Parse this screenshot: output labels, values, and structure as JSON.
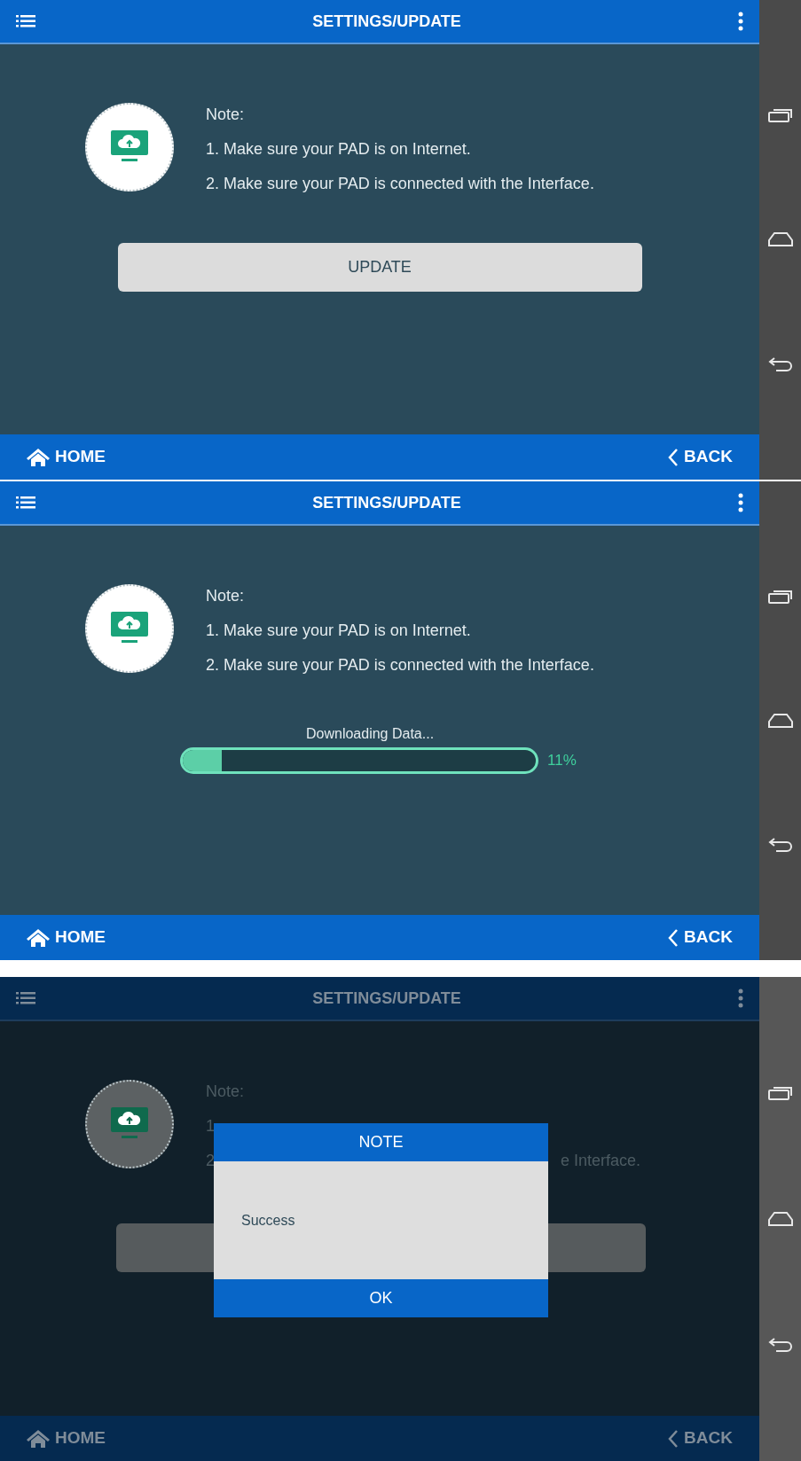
{
  "screens": [
    {
      "kind": "update",
      "dimmed": false,
      "header": {
        "title": "SETTINGS/UPDATE"
      },
      "note": {
        "title": "Note:",
        "lines": [
          {
            "text": "1. Make sure your PAD is on Internet."
          },
          {
            "text": "2. Make sure your PAD is connected with the Interface."
          }
        ]
      },
      "update_button": "UPDATE",
      "footer": {
        "home": "HOME",
        "back": "BACK"
      }
    },
    {
      "kind": "progress",
      "dimmed": false,
      "header": {
        "title": "SETTINGS/UPDATE"
      },
      "note": {
        "title": "Note:",
        "lines": [
          {
            "text": "1. Make sure your PAD is on Internet."
          },
          {
            "text": "2. Make sure your PAD is connected with the Interface."
          }
        ]
      },
      "progress": {
        "label": "Downloading Data...",
        "level": 0.11,
        "reading": "11%"
      },
      "footer": {
        "home": "HOME",
        "back": "BACK"
      }
    },
    {
      "kind": "dialog",
      "dimmed": true,
      "header": {
        "title": "SETTINGS/UPDATE"
      },
      "note": {
        "title": "Note:",
        "lines": [
          {
            "text": "1"
          },
          {
            "text": "2",
            "tail": "e Interface."
          }
        ]
      },
      "dialog": {
        "title": "NOTE",
        "message": "Success",
        "ok": "OK"
      },
      "footer": {
        "home": "HOME",
        "back": "BACK"
      }
    }
  ]
}
